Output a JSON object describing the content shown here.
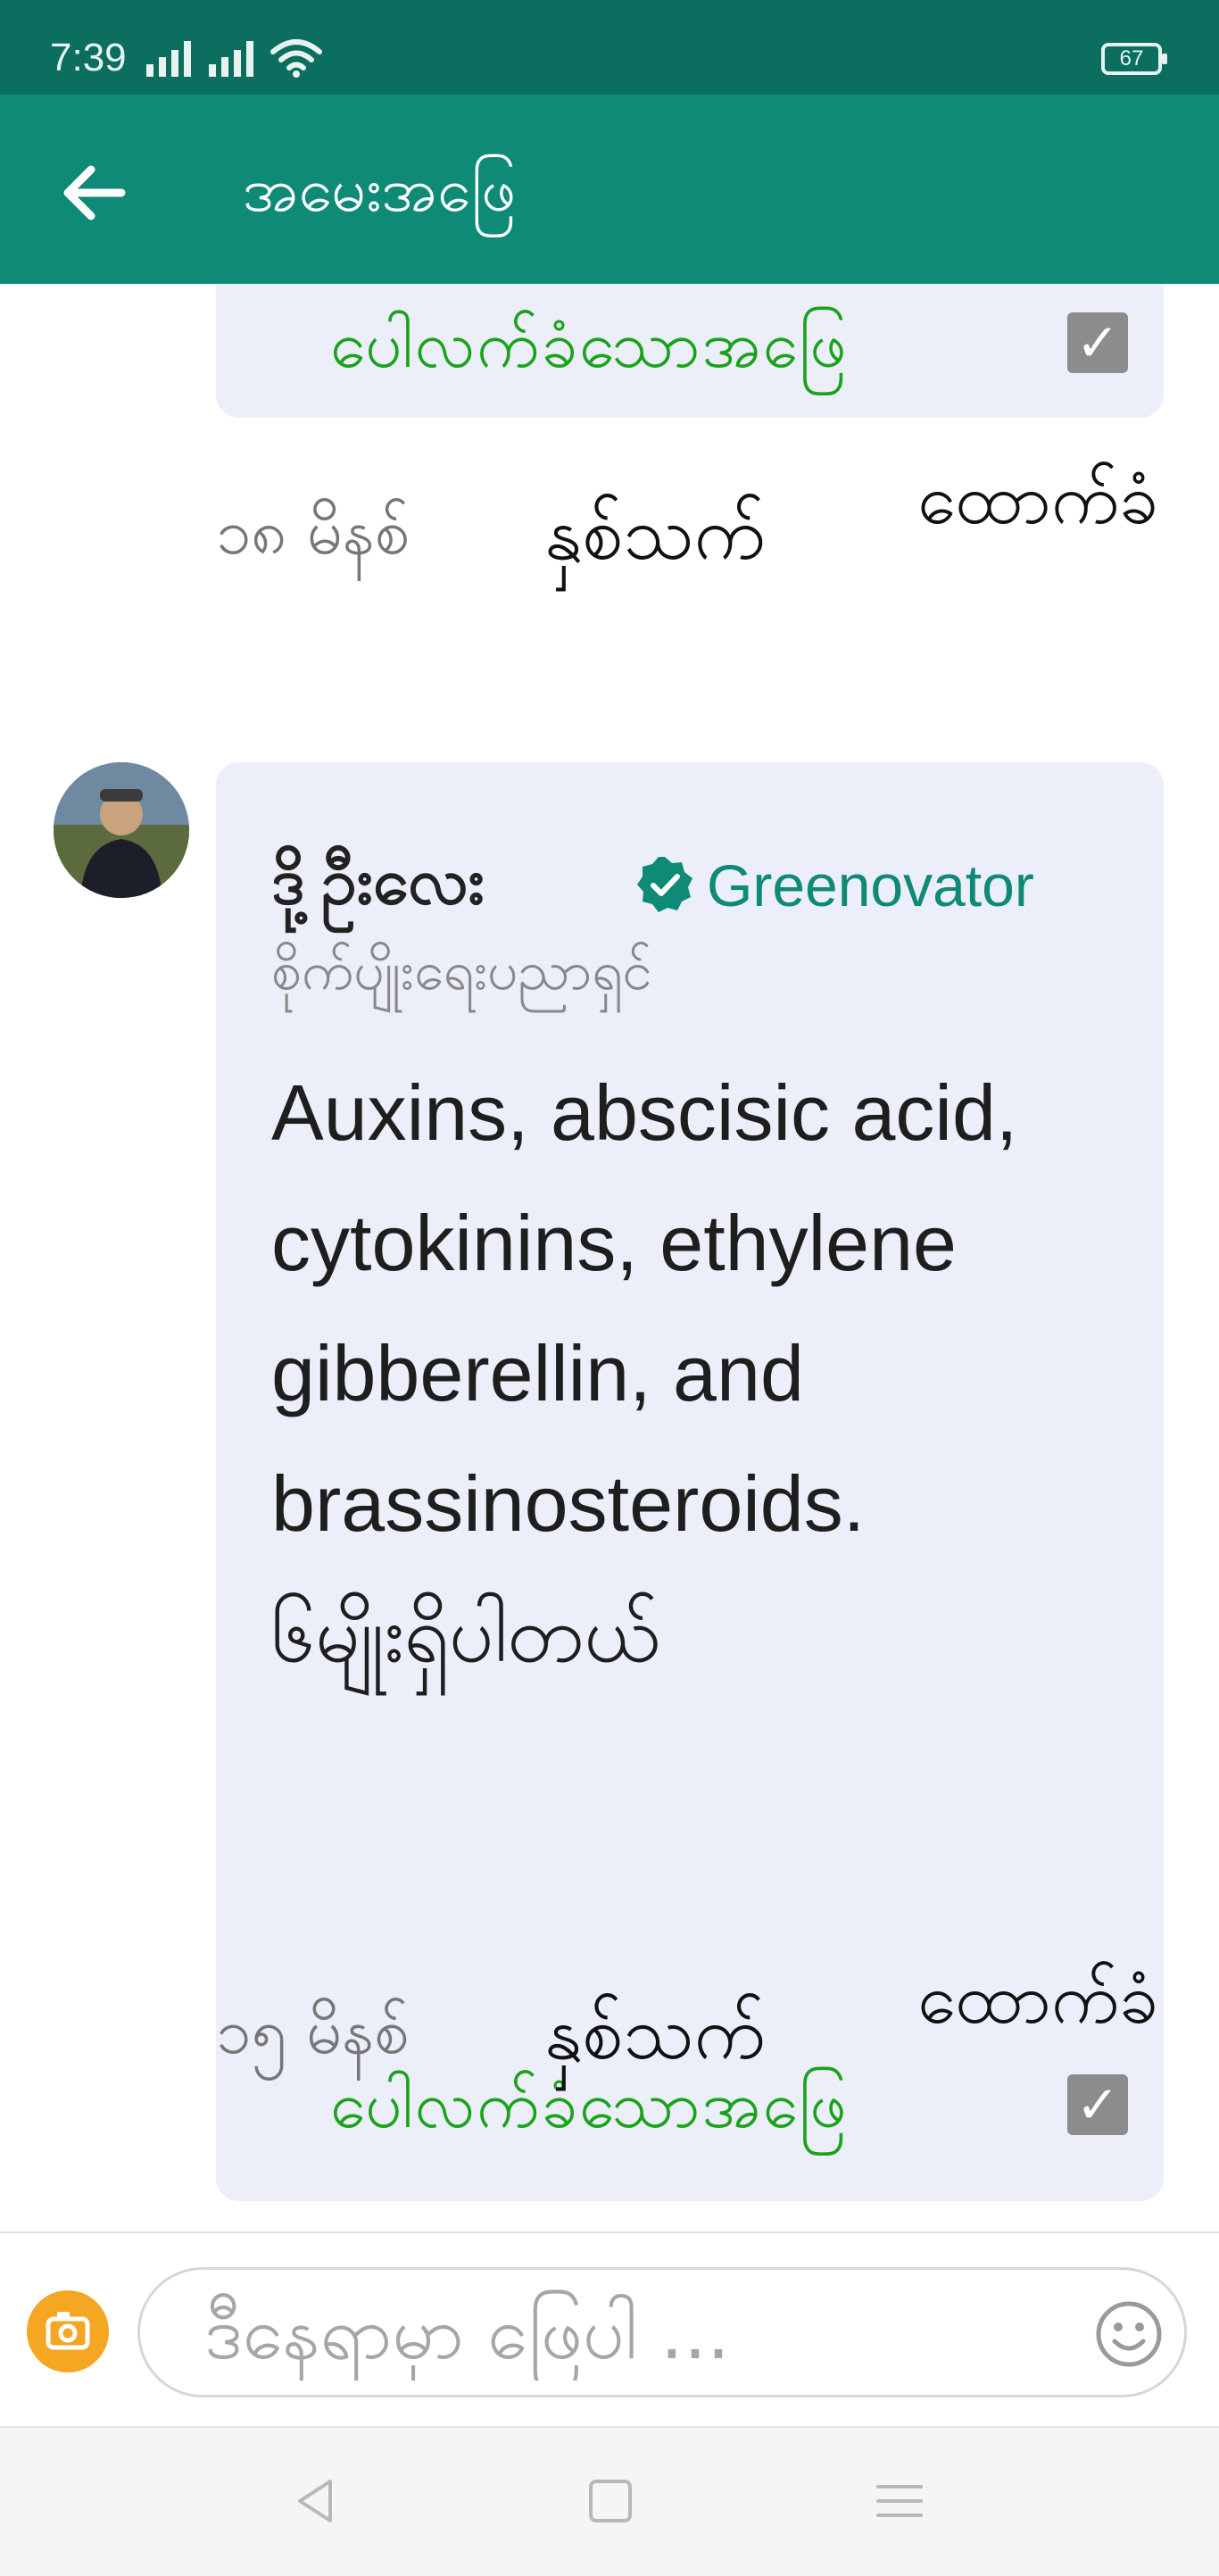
{
  "status_bar": {
    "time": "7:39",
    "battery": "67"
  },
  "app_bar": {
    "title": "အမေးအဖြေ"
  },
  "answers": [
    {
      "accepted_label": "ပေါလက်ခံသောအဖြေ",
      "time": "၁၈ မိနစ်",
      "like_label": "နှစ်သက်",
      "reply_label": "ထောက်ခံ"
    },
    {
      "author_name": "ဒို့ဦးလေး",
      "author_badge": "Greenovator",
      "author_title": "စိုက်ပျိုးရေးပညာရှင်",
      "text_lines": [
        "Auxins, abscisic acid,",
        "cytokinins, ethylene",
        "gibberellin, and",
        "brassinosteroids.",
        "၆မျိုးရှိပါတယ်"
      ],
      "accepted_label": "ပေါလက်ခံသောအဖြေ",
      "time": "၁၅ မိနစ်",
      "like_label": "နှစ်သက်",
      "reply_label": "ထောက်ခံ"
    }
  ],
  "composer": {
    "placeholder": "ဒီနေရာမှာ ဖြေပါ ..."
  },
  "colors": {
    "status_bar": "#0b6e5f",
    "app_bar": "#0e8a76",
    "accepted_green": "#1aa31a",
    "card_bg": "#eceef9",
    "camera_button": "#f5a623"
  },
  "icons": {
    "back": "arrow-left-icon",
    "verified": "verified-check-icon",
    "checkbox": "checkbox-checked-icon",
    "camera": "camera-icon",
    "emoji": "smiley-icon",
    "nav_back": "triangle-back-icon",
    "nav_home": "square-home-icon",
    "nav_menu": "menu-lines-icon"
  }
}
